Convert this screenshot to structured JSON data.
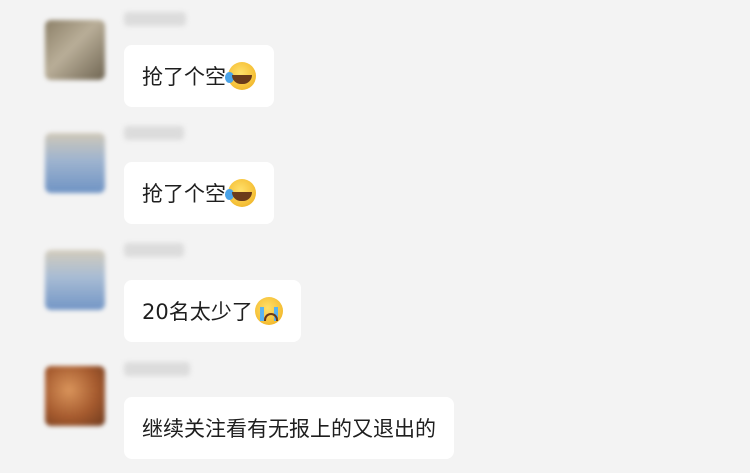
{
  "messages": [
    {
      "avatar": "blurred-avatar",
      "text": "抢了个空",
      "emoji": "laughing-crying-emoji"
    },
    {
      "avatar": "blurred-avatar",
      "text": "抢了个空",
      "emoji": "laughing-crying-emoji"
    },
    {
      "avatar": "blurred-avatar",
      "text": "20名太少了",
      "emoji": "crying-emoji"
    },
    {
      "avatar": "blurred-avatar",
      "text": "继续关注看有无报上的又退出的",
      "emoji": ""
    }
  ]
}
